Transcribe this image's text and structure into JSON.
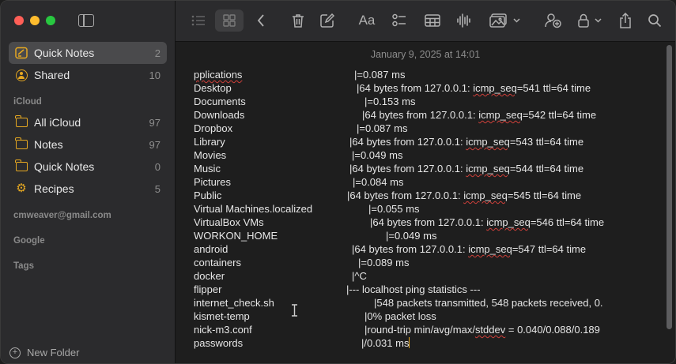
{
  "sidebar": {
    "items": [
      {
        "label": "Quick Notes",
        "count": "2"
      },
      {
        "label": "Shared",
        "count": "10"
      }
    ],
    "icloud_header": "iCloud",
    "icloud_items": [
      {
        "label": "All iCloud",
        "count": "97"
      },
      {
        "label": "Notes",
        "count": "97"
      },
      {
        "label": "Quick Notes",
        "count": "0"
      },
      {
        "label": "Recipes",
        "count": "5"
      }
    ],
    "account_header": "cmweaver@gmail.com",
    "google_header": "Google",
    "tags_header": "Tags",
    "new_folder": "New Folder"
  },
  "toolbar": {
    "font_label": "Aa"
  },
  "note": {
    "date": "January 9, 2025 at 14:01",
    "lines": [
      {
        "l": "pplications",
        "r": "|=0.087 ms"
      },
      {
        "l": "Desktop",
        "r": "|64 bytes from 127.0.0.1: icmp_seq=541 ttl=64 time"
      },
      {
        "l": "Documents",
        "r": "|=0.153 ms"
      },
      {
        "l": "Downloads",
        "r": "|64 bytes from 127.0.0.1: icmp_seq=542 ttl=64 time"
      },
      {
        "l": "Dropbox",
        "r": "|=0.087 ms"
      },
      {
        "l": "Library",
        "r": "|64 bytes from 127.0.0.1: icmp_seq=543 ttl=64 time"
      },
      {
        "l": "Movies",
        "r": "|=0.049 ms"
      },
      {
        "l": "Music",
        "r": "|64 bytes from 127.0.0.1: icmp_seq=544 ttl=64 time"
      },
      {
        "l": "Pictures",
        "r": "|=0.084 ms"
      },
      {
        "l": "Public",
        "r": "|64 bytes from 127.0.0.1: icmp_seq=545 ttl=64 time"
      },
      {
        "l": "Virtual Machines.localized",
        "r": "|=0.055 ms"
      },
      {
        "l": "VirtualBox VMs",
        "r": "|64 bytes from 127.0.0.1: icmp_seq=546 ttl=64 time"
      },
      {
        "l": "WORKON_HOME",
        "r": "|=0.049 ms"
      },
      {
        "l": "android",
        "r": "|64 bytes from 127.0.0.1: icmp_seq=547 ttl=64 time"
      },
      {
        "l": "containers",
        "r": "|=0.089 ms"
      },
      {
        "l": "docker",
        "r": "|^C"
      },
      {
        "l": "flipper",
        "r": "|--- localhost ping statistics ---"
      },
      {
        "l": "internet_check.sh",
        "r": "|548 packets transmitted, 548 packets received, 0."
      },
      {
        "l": "kismet-temp",
        "r": "|0% packet loss"
      },
      {
        "l": "nick-m3.conf",
        "r": "|round-trip min/avg/max/stddev = 0.040/0.088/0.189"
      },
      {
        "l": "passwords",
        "r": "|/0.031 ms"
      }
    ]
  },
  "colors": {
    "accent": "#e6a821",
    "sidebar_bg": "#2b2b2d",
    "editor_bg": "#1e1e1e"
  }
}
